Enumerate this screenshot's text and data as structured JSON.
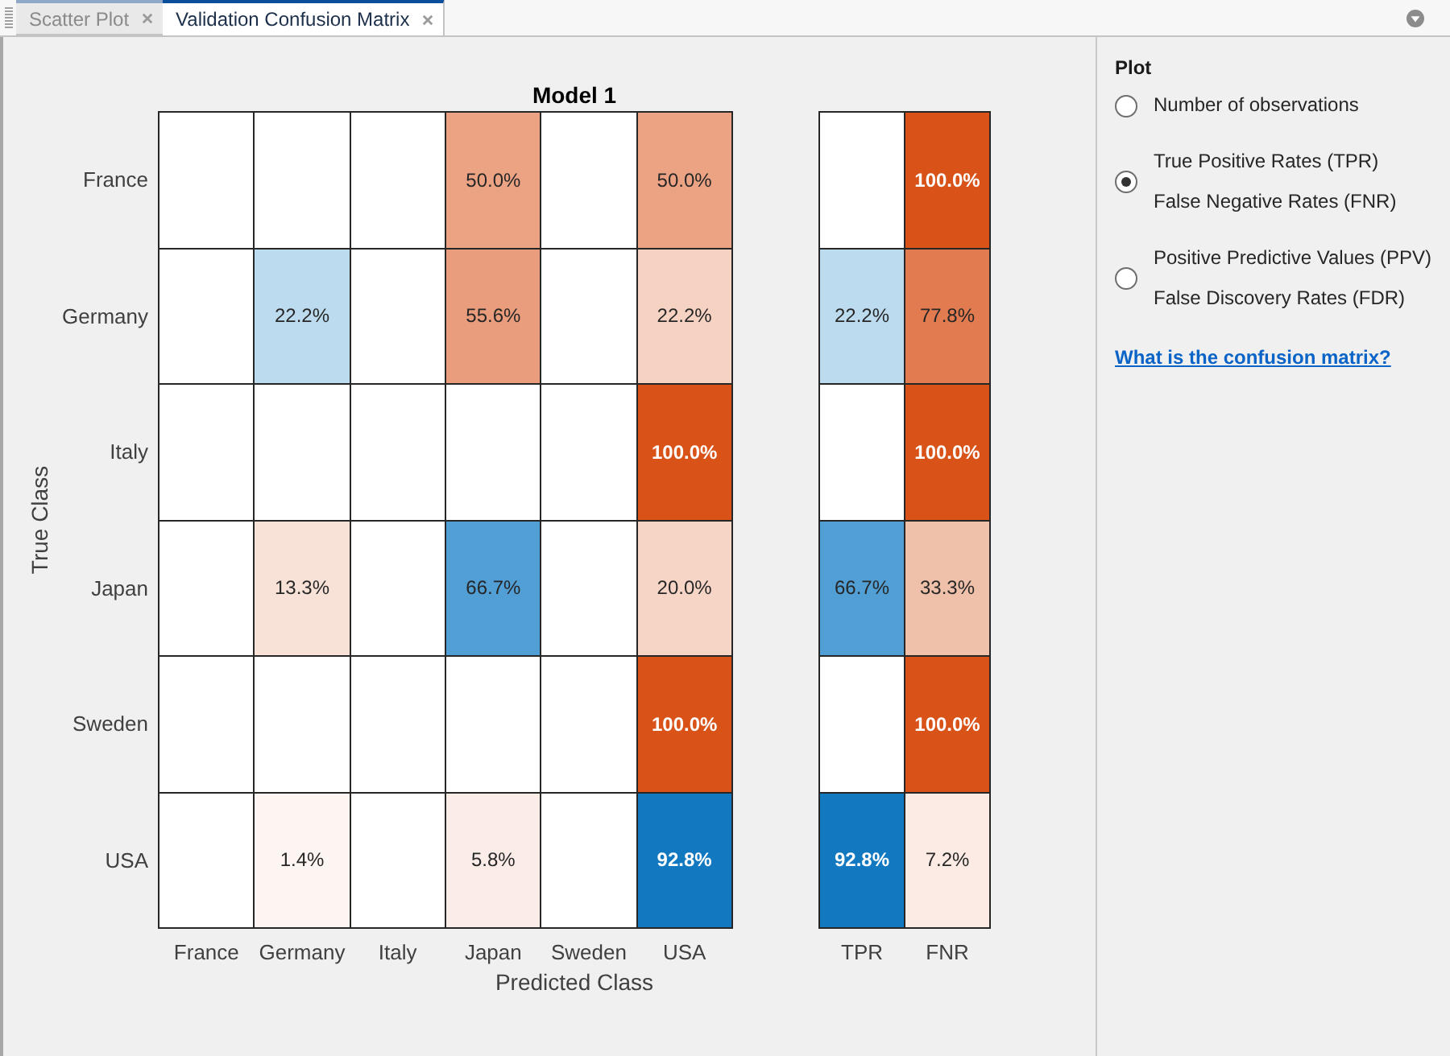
{
  "tabs": [
    {
      "label": "Scatter Plot",
      "selected": false
    },
    {
      "label": "Validation Confusion Matrix",
      "selected": true
    }
  ],
  "matrix": {
    "title": "Model 1",
    "ylabel": "True Class",
    "rows": [
      {
        "label": "France",
        "cells": [
          {
            "color": "#ffffff"
          },
          {
            "color": "#ffffff"
          },
          {
            "color": "#ffffff"
          },
          {
            "text": "50.0%",
            "color": "#eba384"
          },
          {
            "color": "#ffffff"
          },
          {
            "text": "50.0%",
            "color": "#eba384"
          }
        ],
        "rates": [
          {
            "color": "#ffffff"
          },
          {
            "text": "100.0%",
            "color": "#d95319"
          }
        ]
      },
      {
        "label": "Germany",
        "cells": [
          {
            "color": "#ffffff"
          },
          {
            "text": "22.2%",
            "color": "#bddbee"
          },
          {
            "color": "#ffffff"
          },
          {
            "text": "55.6%",
            "color": "#e99d7c"
          },
          {
            "color": "#ffffff"
          },
          {
            "text": "22.2%",
            "color": "#f6d2c3"
          }
        ],
        "rates": [
          {
            "text": "22.2%",
            "color": "#bddbee"
          },
          {
            "text": "77.8%",
            "color": "#e27b4f"
          }
        ]
      },
      {
        "label": "Italy",
        "cells": [
          {
            "color": "#ffffff"
          },
          {
            "color": "#ffffff"
          },
          {
            "color": "#ffffff"
          },
          {
            "color": "#ffffff"
          },
          {
            "color": "#ffffff"
          },
          {
            "text": "100.0%",
            "color": "#d95319"
          }
        ],
        "rates": [
          {
            "color": "#ffffff"
          },
          {
            "text": "100.0%",
            "color": "#d95319"
          }
        ]
      },
      {
        "label": "Japan",
        "cells": [
          {
            "color": "#ffffff"
          },
          {
            "text": "13.3%",
            "color": "#f8e1d7"
          },
          {
            "color": "#ffffff"
          },
          {
            "text": "66.7%",
            "color": "#519fd4"
          },
          {
            "color": "#ffffff"
          },
          {
            "text": "20.0%",
            "color": "#f6d5c7"
          }
        ],
        "rates": [
          {
            "text": "66.7%",
            "color": "#519fd4"
          },
          {
            "text": "33.3%",
            "color": "#f0c1aa"
          }
        ]
      },
      {
        "label": "Sweden",
        "cells": [
          {
            "color": "#ffffff"
          },
          {
            "color": "#ffffff"
          },
          {
            "color": "#ffffff"
          },
          {
            "color": "#ffffff"
          },
          {
            "color": "#ffffff"
          },
          {
            "text": "100.0%",
            "color": "#d95319"
          }
        ],
        "rates": [
          {
            "color": "#ffffff"
          },
          {
            "text": "100.0%",
            "color": "#d95319"
          }
        ]
      },
      {
        "label": "USA",
        "cells": [
          {
            "color": "#ffffff"
          },
          {
            "text": "1.4%",
            "color": "#fdf5f2"
          },
          {
            "color": "#ffffff"
          },
          {
            "text": "5.8%",
            "color": "#fbece7"
          },
          {
            "color": "#ffffff"
          },
          {
            "text": "92.8%",
            "color": "#1279c1"
          }
        ],
        "rates": [
          {
            "text": "92.8%",
            "color": "#1279c1"
          },
          {
            "text": "7.2%",
            "color": "#fbebe4"
          }
        ]
      }
    ],
    "bottom_labels": [
      "France",
      "Germany",
      "Italy",
      "Japan",
      "Sweden",
      "USA"
    ],
    "rate_bottom_labels": [
      "TPR",
      "FNR"
    ],
    "xlabel": "Predicted Class"
  },
  "plot_panel": {
    "title": "Plot",
    "options": [
      {
        "lines": [
          "Number of observations"
        ],
        "selected": false
      },
      {
        "lines": [
          "True Positive Rates (TPR)",
          "False Negative Rates (FNR)"
        ],
        "selected": true
      },
      {
        "lines": [
          "Positive Predictive Values (PPV)",
          "False Discovery Rates (FDR)"
        ],
        "selected": false
      }
    ],
    "link": "What is the confusion matrix?"
  }
}
